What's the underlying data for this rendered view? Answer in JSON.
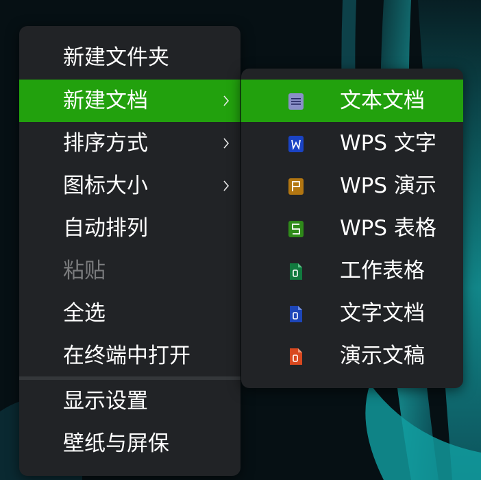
{
  "main_menu": {
    "items": [
      {
        "label": "新建文件夹"
      },
      {
        "label": "新建文档",
        "active": true,
        "has_submenu": true
      },
      {
        "label": "排序方式",
        "has_submenu": true
      },
      {
        "label": "图标大小",
        "has_submenu": true
      },
      {
        "label": "自动排列"
      },
      {
        "label": "粘贴",
        "disabled": true
      },
      {
        "label": "全选"
      },
      {
        "label": "在终端中打开"
      },
      {
        "label": "显示设置"
      },
      {
        "label": "壁纸与屏保"
      }
    ]
  },
  "submenu": {
    "items": [
      {
        "label": "文本文档",
        "icon": "text-document-icon",
        "active": true
      },
      {
        "label": "WPS 文字",
        "icon": "wps-writer-icon"
      },
      {
        "label": "WPS 演示",
        "icon": "wps-presentation-icon"
      },
      {
        "label": "WPS 表格",
        "icon": "wps-spreadsheet-icon"
      },
      {
        "label": "工作表格",
        "icon": "office-spreadsheet-icon"
      },
      {
        "label": "文字文档",
        "icon": "office-document-icon"
      },
      {
        "label": "演示文稿",
        "icon": "office-presentation-icon"
      }
    ]
  },
  "colors": {
    "highlight": "#22a10d",
    "menu_bg": "#212326",
    "text": "#ffffff",
    "disabled_text": "#7a7b7d"
  }
}
